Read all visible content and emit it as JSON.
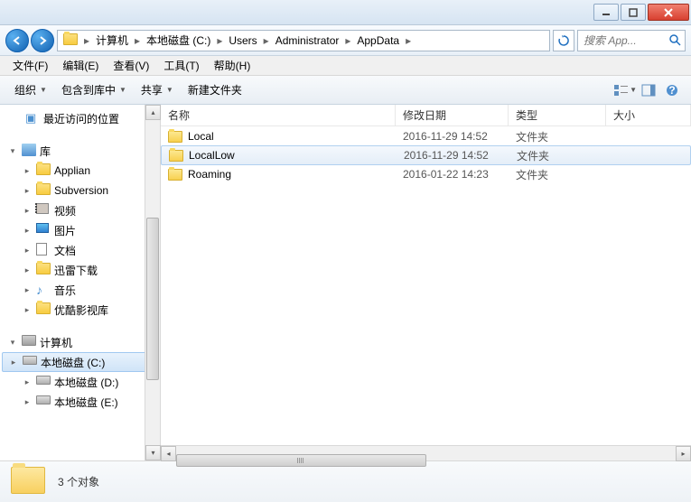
{
  "titlebar": {},
  "address": {
    "crumbs": [
      "计算机",
      "本地磁盘 (C:)",
      "Users",
      "Administrator",
      "AppData"
    ]
  },
  "search": {
    "placeholder": "搜索 App..."
  },
  "menu": {
    "file": "文件(F)",
    "edit": "编辑(E)",
    "view": "查看(V)",
    "tools": "工具(T)",
    "help": "帮助(H)"
  },
  "toolbar": {
    "organize": "组织",
    "include": "包含到库中",
    "share": "共享",
    "newfolder": "新建文件夹"
  },
  "columns": {
    "name": "名称",
    "date": "修改日期",
    "type": "类型",
    "size": "大小"
  },
  "files": [
    {
      "name": "Local",
      "date": "2016-11-29 14:52",
      "type": "文件夹",
      "selected": false
    },
    {
      "name": "LocalLow",
      "date": "2016-11-29 14:52",
      "type": "文件夹",
      "selected": true
    },
    {
      "name": "Roaming",
      "date": "2016-01-22 14:23",
      "type": "文件夹",
      "selected": false
    }
  ],
  "sidebar": {
    "recent": "最近访问的位置",
    "libraries": "库",
    "lib_items": [
      "Applian",
      "Subversion",
      "视频",
      "图片",
      "文档",
      "迅雷下载",
      "音乐",
      "优酷影视库"
    ],
    "computer": "计算机",
    "drives": [
      "本地磁盘 (C:)",
      "本地磁盘 (D:)",
      "本地磁盘 (E:)"
    ],
    "selected_drive": 0
  },
  "status": {
    "text": "3 个对象"
  }
}
